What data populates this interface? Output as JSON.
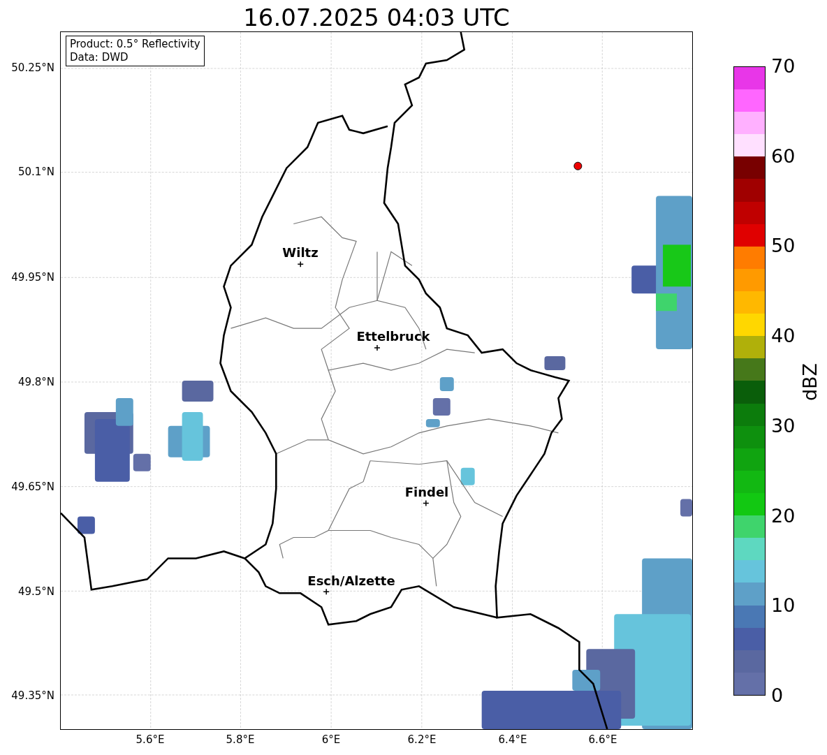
{
  "title": "16.07.2025 04:03 UTC",
  "legend": [
    "Product: 0.5° Reflectivity",
    "Data: DWD"
  ],
  "lat_ticks": [
    "50.25°N",
    "50.1°N",
    "49.95°N",
    "49.8°N",
    "49.65°N",
    "49.5°N",
    "49.35°N"
  ],
  "lon_ticks": [
    "5.6°E",
    "5.8°E",
    "6°E",
    "6.2°E",
    "6.4°E",
    "6.6°E"
  ],
  "cities": [
    {
      "name": "Wiltz"
    },
    {
      "name": "Ettelbruck"
    },
    {
      "name": "Findel"
    },
    {
      "name": "Esch/Alzette"
    }
  ],
  "colorbar": {
    "label": "dBZ",
    "ticks": [
      "70",
      "60",
      "50",
      "40",
      "30",
      "20",
      "10",
      "0"
    ],
    "bands": [
      {
        "color": "#6470a8"
      },
      {
        "color": "#5a68a0"
      },
      {
        "color": "#4a5ea6"
      },
      {
        "color": "#4a78b4"
      },
      {
        "color": "#5ea0c8"
      },
      {
        "color": "#66c4dc"
      },
      {
        "color": "#5ed8c0"
      },
      {
        "color": "#3fd46c"
      },
      {
        "color": "#12c812"
      },
      {
        "color": "#12b812"
      },
      {
        "color": "#10a410"
      },
      {
        "color": "#0e900e"
      },
      {
        "color": "#0c7c0c"
      },
      {
        "color": "#0a5e0a"
      },
      {
        "color": "#46781a"
      },
      {
        "color": "#b0b00a"
      },
      {
        "color": "#ffd700"
      },
      {
        "color": "#ffb800"
      },
      {
        "color": "#ff9a00"
      },
      {
        "color": "#ff7c00"
      },
      {
        "color": "#e00000"
      },
      {
        "color": "#c00000"
      },
      {
        "color": "#a00000"
      },
      {
        "color": "#780000"
      },
      {
        "color": "#ffe0ff"
      },
      {
        "color": "#ffb0ff"
      },
      {
        "color": "#ff66ff"
      },
      {
        "color": "#e836e8"
      }
    ]
  }
}
